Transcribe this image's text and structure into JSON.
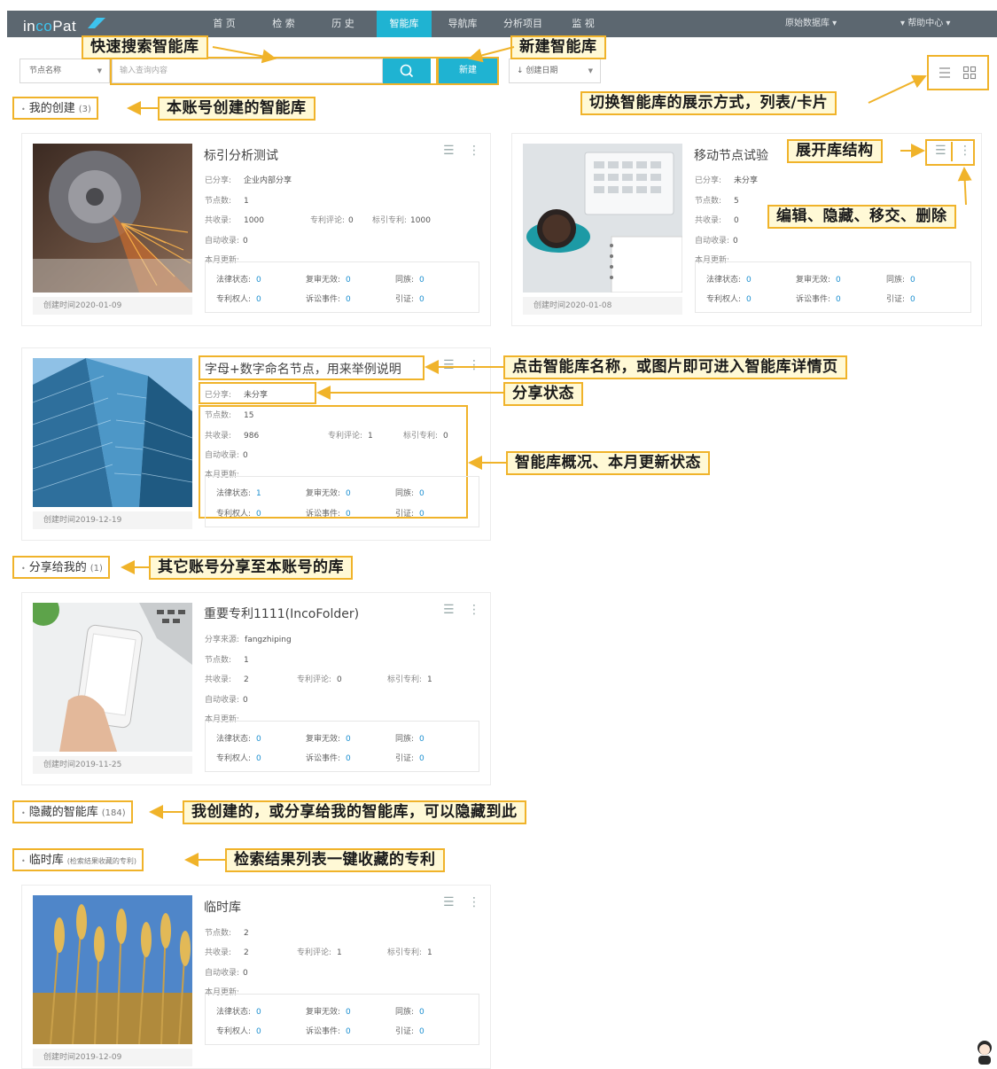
{
  "nav": {
    "logo": [
      "in",
      "co",
      "Pat"
    ],
    "items": [
      "首 页",
      "检 索",
      "历 史",
      "智能库",
      "导航库",
      "分析项目",
      "监 视"
    ],
    "active_index": 3,
    "right": [
      "原始数据库 ▾",
      "▾ 帮助中心 ▾"
    ]
  },
  "search": {
    "field_label": "节点名称",
    "placeholder": "输入查询内容",
    "new_label": "新建",
    "sort_label": "↓ 创建日期"
  },
  "labels": {
    "shared": "已分享:",
    "share_source": "分享来源:",
    "nodes": "节点数:",
    "total": "共收录:",
    "patent_review": "专利评论:",
    "tagged": "标引专利:",
    "auto": "自动收录:",
    "monthly": "本月更新:",
    "legal": "法律状态:",
    "reexam": "复审无效:",
    "family": "同族:",
    "owner": "专利权人:",
    "lawsuit": "诉讼事件:",
    "citation": "引证:"
  },
  "sections": [
    {
      "title": "我的创建",
      "count": "(3)"
    },
    {
      "title": "分享给我的",
      "count": "(1)"
    },
    {
      "title": "隐藏的智能库",
      "count": "(184)"
    },
    {
      "title": "临时库",
      "count": "(检索结果收藏的专利)"
    }
  ],
  "cards": [
    {
      "title": "标引分析测试",
      "share": "企业内部分享",
      "nodes": "1",
      "total": "1000",
      "review": "0",
      "tagged": "1000",
      "auto": "0",
      "legal": "0",
      "reexam": "0",
      "family": "0",
      "owner": "0",
      "lawsuit": "0",
      "citation": "0",
      "created": "创建时间2020-01-09"
    },
    {
      "title": "移动节点试验",
      "share": "未分享",
      "nodes": "5",
      "total": "0",
      "auto": "0",
      "legal": "0",
      "reexam": "0",
      "family": "0",
      "owner": "0",
      "lawsuit": "0",
      "citation": "0",
      "created": "创建时间2020-01-08"
    },
    {
      "title": "字母+数字命名节点，用来举例说明",
      "share": "未分享",
      "nodes": "15",
      "total": "986",
      "review": "1",
      "tagged": "0",
      "auto": "0",
      "legal": "1",
      "reexam": "0",
      "family": "0",
      "owner": "0",
      "lawsuit": "0",
      "citation": "0",
      "created": "创建时间2019-12-19"
    },
    {
      "title": "重要专利1111(IncoFolder)",
      "share": "fangzhiping",
      "nodes": "1",
      "total": "2",
      "review": "0",
      "tagged": "1",
      "auto": "0",
      "legal": "0",
      "reexam": "0",
      "family": "0",
      "owner": "0",
      "lawsuit": "0",
      "citation": "0",
      "created": "创建时间2019-11-25"
    },
    {
      "title": "临时库",
      "nodes": "2",
      "total": "2",
      "review": "1",
      "tagged": "1",
      "auto": "0",
      "legal": "0",
      "reexam": "0",
      "family": "0",
      "owner": "0",
      "lawsuit": "0",
      "citation": "0",
      "created": "创建时间2019-12-09"
    }
  ],
  "annotations": {
    "quick_search": "快速搜索智能库",
    "new_lib": "新建智能库",
    "my_created": "本账号创建的智能库",
    "view_switch": "切换智能库的展示方式，列表/卡片",
    "expand": "展开库结构",
    "edit": "编辑、隐藏、移交、删除",
    "click_name": "点击智能库名称，或图片即可进入智能库详情页",
    "share_state": "分享状态",
    "overview": "智能库概况、本月更新状态",
    "shared_to_me": "其它账号分享至本账号的库",
    "hidden": "我创建的，或分享给我的智能库，可以隐藏到此",
    "temp": "检索结果列表一键收藏的专利"
  },
  "colors": {
    "accent": "#1fb3d2",
    "highlight": "#f0b32a",
    "nav_bg": "#5c6770",
    "value_blue": "#1c8fd0"
  }
}
